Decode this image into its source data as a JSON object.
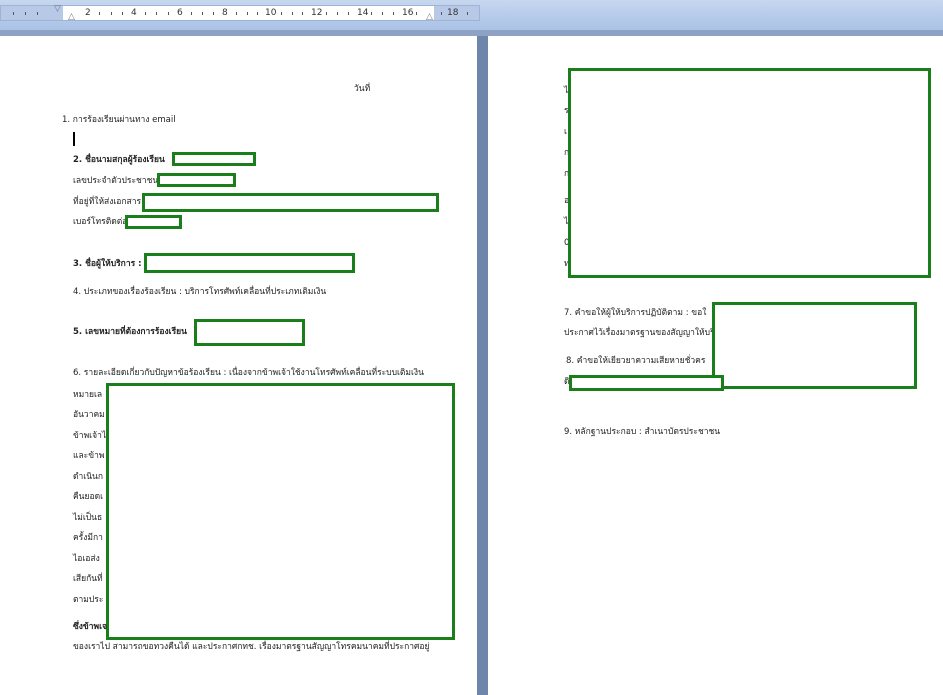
{
  "ruler": {
    "numbers": [
      "2",
      "4",
      "6",
      "8",
      "10",
      "12",
      "14",
      "16",
      "18"
    ]
  },
  "left_page": {
    "date_label": "วันที่",
    "item1": "1.  การร้องเรียนผ่านทาง email",
    "item2_label": "2. ชื่อนามสกุลผู้ร้องเรียน",
    "id_label": "เลขประจำตัวประชาชน",
    "address_label": "ที่อยู่ที่ให้ส่งเอกสาร",
    "phone_label": "เบอร์โทรติดต่อ",
    "item3_label": "3. ชื่อผู้ให้บริการ :",
    "item4": "4. ประเภทของเรื่องร้องเรียน : บริการโทรศัพท์เคลื่อนที่ประเภทเติมเงิน",
    "item5_label": "5. เลขหมายที่ต้องการร้องเรียน",
    "item6_header": "6. รายละเอียดเกี่ยวกับปัญหาข้อร้องเรียน  :  เนื่องจากข้าพเจ้าใช้งานโทรศัพท์เคลื่อนที่ระบบเติมเงิน",
    "item6_lines": [
      "หมายเล",
      "อันวาคม",
      "ข้าพเจ้าไ",
      "และข้าพ",
      "ดำเนินก",
      "คืนยอดเ",
      "ไม่เป็นธ",
      "ครั้งมีกา",
      "ไอเอส่ง",
      "เสียกันที่",
      "ตามประ"
    ],
    "closing_bold": "ซึ่งข้าพเจ",
    "closing_line": "ของเราไป สามารถขอทวงคืนได้ และประกาศกทช. เรื่องมาตรฐานสัญญาโทรคมนาคมที่ประกาศอยู่"
  },
  "right_page": {
    "top_fragments": [
      "ไ",
      "ร",
      "เ",
      "ก",
      "ก",
      "อ",
      "ไ",
      "0",
      "ท"
    ],
    "item7_label": "7. คำขอให้ผู้ให้บริการปฏิบัติตาม : ขอใ",
    "item7_line2": "ประกาศไว้เรื่องมาตรฐานของสัญญาให้บริก",
    "item8_label": "8. คำขอให้เยียวยาความเสียหายชั่วคร",
    "item8_line2": "ดิ",
    "item9": "9. หลักฐานประกอบ : สำเนาบัตรประชาชน"
  },
  "colors": {
    "redaction": "#1a7f1a"
  }
}
